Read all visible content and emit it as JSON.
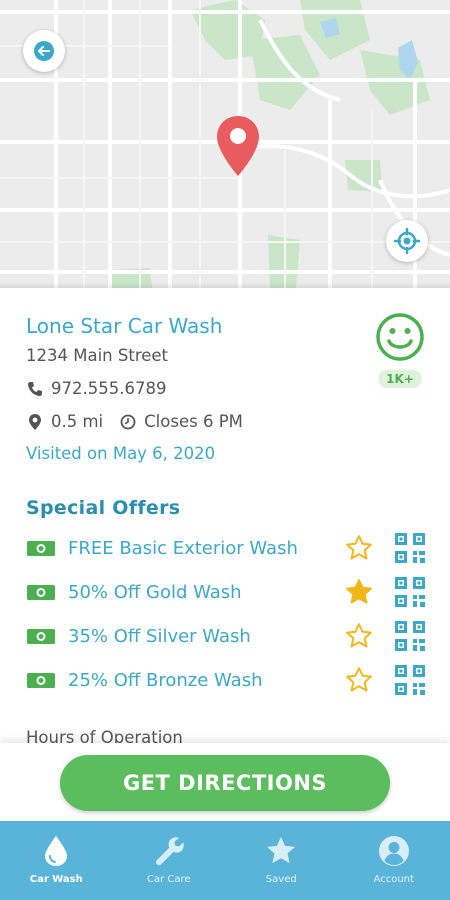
{
  "map": {
    "back_icon": "arrow-left-icon",
    "locate_icon": "crosshair-icon",
    "pin_icon": "map-pin-icon",
    "colors": {
      "pin": "#e85c5f",
      "road": "#ffffff",
      "park": "#c9e6c9",
      "water": "#aed6ee",
      "buttons_icon": "#3aa9c9"
    }
  },
  "business": {
    "name": "Lone Star Car Wash",
    "address": "1234 Main Street",
    "phone": "972.555.6789",
    "distance": "0.5 mi",
    "hours_status": "Closes 6 PM",
    "visited": "Visited on May 6, 2020",
    "rating_icon": "smiley-face-icon",
    "rating_count": "1K+"
  },
  "offers": {
    "title": "Special Offers",
    "items": [
      {
        "label": "FREE Basic Exterior Wash",
        "saved": false
      },
      {
        "label": "50% Off Gold Wash",
        "saved": true
      },
      {
        "label": "35% Off Silver Wash",
        "saved": false
      },
      {
        "label": "25% Off Bronze Wash",
        "saved": false
      }
    ]
  },
  "hours_heading": "Hours of Operation",
  "directions_button": "GET DIRECTIONS",
  "nav": {
    "items": [
      {
        "label": "Car Wash",
        "icon": "water-drop-icon",
        "active": true
      },
      {
        "label": "Car Care",
        "icon": "wrench-icon",
        "active": false
      },
      {
        "label": "Saved",
        "icon": "star-icon",
        "active": false
      },
      {
        "label": "Account",
        "icon": "user-icon",
        "active": false
      }
    ]
  },
  "colors": {
    "accent": "#3aa9c9",
    "offers_title": "#2a8fae",
    "green": "#5bbd5e",
    "star": "#f2b718",
    "nav_bg": "#5ab4d9"
  }
}
